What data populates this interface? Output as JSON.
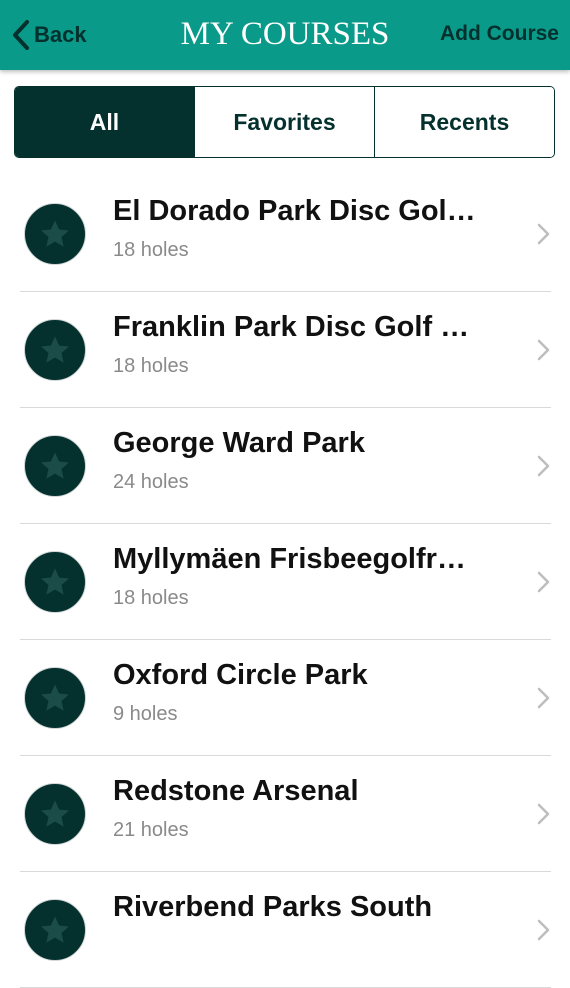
{
  "header": {
    "back_label": "Back",
    "title": "MY COURSES",
    "add_label": "Add Course",
    "color": "#0a9a8a"
  },
  "tabs": [
    {
      "label": "All",
      "active": true
    },
    {
      "label": "Favorites",
      "active": false
    },
    {
      "label": "Recents",
      "active": false
    }
  ],
  "courses": [
    {
      "name": "El Dorado Park Disc Gol…",
      "holes": "18 holes",
      "icon": "star-icon"
    },
    {
      "name": "Franklin Park Disc Golf …",
      "holes": "18 holes",
      "icon": "star-icon"
    },
    {
      "name": "George Ward Park",
      "holes": "24 holes",
      "icon": "star-icon"
    },
    {
      "name": "Myllymäen Frisbeegolfr…",
      "holes": "18 holes",
      "icon": "star-icon"
    },
    {
      "name": "Oxford Circle Park",
      "holes": "9 holes",
      "icon": "star-icon"
    },
    {
      "name": "Redstone Arsenal",
      "holes": "21 holes",
      "icon": "star-icon"
    },
    {
      "name": "Riverbend Parks South",
      "holes": "",
      "icon": "star-icon"
    }
  ],
  "colors": {
    "dark": "#04302d",
    "divider": "#d9d9d9",
    "secondary_text": "#8a8a8a"
  }
}
